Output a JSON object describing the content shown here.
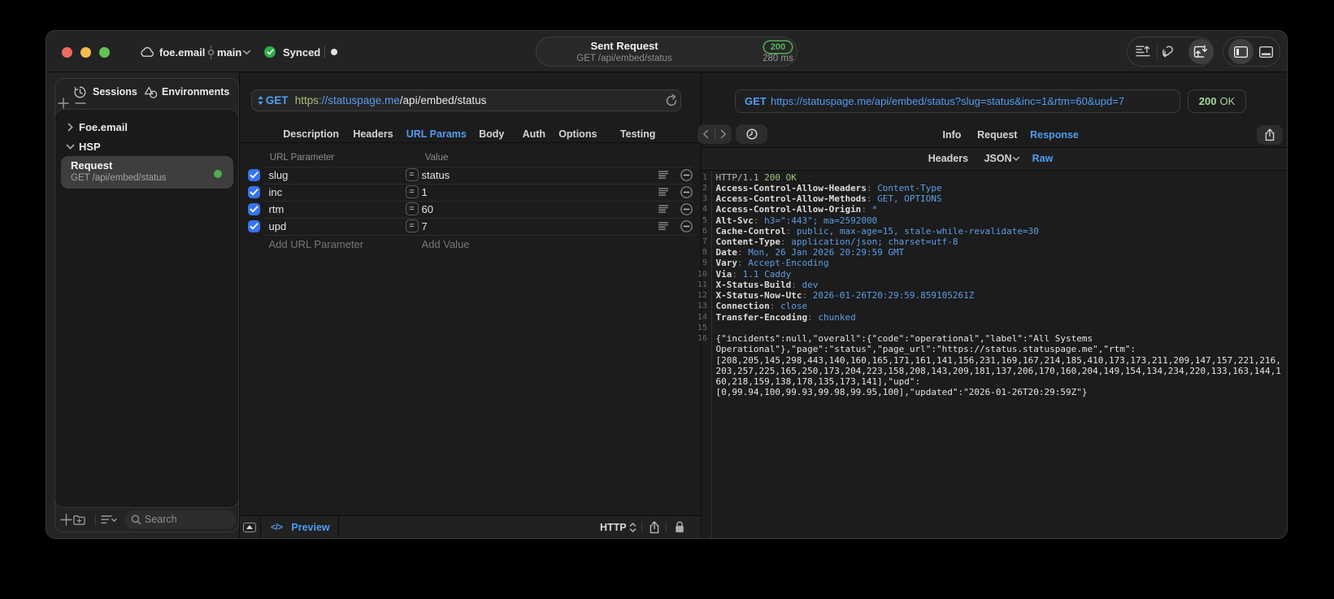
{
  "titlebar": {
    "project": "foe.email",
    "branch": "main",
    "sync_status": "Synced",
    "center_pill": {
      "title": "Sent Request",
      "subtitle": "GET /api/embed/status",
      "status_code": "200",
      "duration": "280 ms"
    }
  },
  "sidebar": {
    "tabs": [
      {
        "label": "Sessions",
        "icon": "history-clock-icon"
      },
      {
        "label": "Environments",
        "icon": "shapes-icon"
      }
    ],
    "tree": {
      "groups": [
        {
          "label": "Foe.email",
          "state": "collapsed"
        },
        {
          "label": "HSP",
          "state": "expanded"
        }
      ],
      "selected_item": {
        "title": "Request",
        "subtitle": "GET /api/embed/status",
        "status_dot_color": "#4caf50"
      }
    },
    "search_placeholder": "Search"
  },
  "request_editor": {
    "method": "GET",
    "url": {
      "scheme": "https",
      "colon": ":",
      "host": "//statuspage.me",
      "path": "/api/embed/status"
    },
    "tabs": [
      "Description",
      "Headers",
      "URL Params",
      "Body",
      "Auth",
      "Options",
      "Testing"
    ],
    "active_tab": "URL Params",
    "params_table": {
      "col_param": "URL Parameter",
      "col_value": "Value",
      "eq_symbol": "=",
      "rows": [
        {
          "name": "slug",
          "value": "status",
          "checked": true
        },
        {
          "name": "inc",
          "value": "1",
          "checked": true
        },
        {
          "name": "rtm",
          "value": "60",
          "checked": true
        },
        {
          "name": "upd",
          "value": "7",
          "checked": true
        }
      ],
      "add_param_placeholder": "Add URL Parameter",
      "add_value_placeholder": "Add Value"
    },
    "footer": {
      "code_glyph": "</>",
      "preview_label": "Preview",
      "protocol": "HTTP"
    }
  },
  "response_viewer": {
    "request_method": "GET",
    "request_url": "https://statuspage.me/api/embed/status?slug=status&inc=1&rtm=60&upd=7",
    "status_code": "200",
    "status_text": "OK",
    "tabs": [
      "Info",
      "Request",
      "Response"
    ],
    "active_tab": "Response",
    "subtabs": [
      "Headers",
      "JSON",
      "Raw"
    ],
    "active_subtab": "Raw",
    "raw_lines": [
      {
        "n": "1",
        "s": [
          [
            "HTTP/1.1 ",
            "sm"
          ],
          [
            "200 OK",
            "sg"
          ]
        ]
      },
      {
        "n": "2",
        "s": [
          [
            "Access-Control-Allow-Headers",
            "sn"
          ],
          [
            ": ",
            "sp"
          ],
          [
            "Content-Type",
            "sv"
          ]
        ]
      },
      {
        "n": "3",
        "s": [
          [
            "Access-Control-Allow-Methods",
            "sn"
          ],
          [
            ": ",
            "sp"
          ],
          [
            "GET, OPTIONS",
            "sv"
          ]
        ]
      },
      {
        "n": "4",
        "s": [
          [
            "Access-Control-Allow-Origin",
            "sn"
          ],
          [
            ": ",
            "sp"
          ],
          [
            "*",
            "sv"
          ]
        ]
      },
      {
        "n": "5",
        "s": [
          [
            "Alt-Svc",
            "sn"
          ],
          [
            ": ",
            "sp"
          ],
          [
            "h3=\":443\"; ma=2592000",
            "sv"
          ]
        ]
      },
      {
        "n": "6",
        "s": [
          [
            "Cache-Control",
            "sn"
          ],
          [
            ": ",
            "sp"
          ],
          [
            "public, max-age=15, stale-while-revalidate=30",
            "sv"
          ]
        ]
      },
      {
        "n": "7",
        "s": [
          [
            "Content-Type",
            "sn"
          ],
          [
            ": ",
            "sp"
          ],
          [
            "application/json; charset=utf-8",
            "sv"
          ]
        ]
      },
      {
        "n": "8",
        "s": [
          [
            "Date",
            "sn"
          ],
          [
            ": ",
            "sp"
          ],
          [
            "Mon, 26 Jan 2026 20:29:59 GMT",
            "sv"
          ]
        ]
      },
      {
        "n": "9",
        "s": [
          [
            "Vary",
            "sn"
          ],
          [
            ": ",
            "sp"
          ],
          [
            "Accept-Encoding",
            "sv"
          ]
        ]
      },
      {
        "n": "10",
        "s": [
          [
            "Via",
            "sn"
          ],
          [
            ": ",
            "sp"
          ],
          [
            "1.1 Caddy",
            "sv"
          ]
        ]
      },
      {
        "n": "11",
        "s": [
          [
            "X-Status-Build",
            "sn"
          ],
          [
            ": ",
            "sp"
          ],
          [
            "dev",
            "sv"
          ]
        ]
      },
      {
        "n": "12",
        "s": [
          [
            "X-Status-Now-Utc",
            "sn"
          ],
          [
            ": ",
            "sp"
          ],
          [
            "2026-01-26T20:29:59.859105261Z",
            "sv"
          ]
        ]
      },
      {
        "n": "13",
        "s": [
          [
            "Connection",
            "sn"
          ],
          [
            ": ",
            "sp"
          ],
          [
            "close",
            "sv"
          ]
        ]
      },
      {
        "n": "14",
        "s": [
          [
            "Transfer-Encoding",
            "sn"
          ],
          [
            ": ",
            "sp"
          ],
          [
            "chunked",
            "sv"
          ]
        ]
      },
      {
        "n": "15",
        "s": []
      },
      {
        "n": "16",
        "s": [
          [
            "{\"incidents\":null,\"overall\":{\"code\":\"operational\",\"label\":\"All Systems",
            "sb"
          ]
        ]
      },
      {
        "n": "",
        "s": [
          [
            "Operational\"},\"page\":\"status\",\"page_url\":\"https://status.statuspage.me\",\"rtm\":",
            "sb"
          ]
        ]
      },
      {
        "n": "",
        "s": [
          [
            "[208,205,145,298,443,140,160,165,171,161,141,156,231,169,167,214,185,410,173,173,211,209,147,157,221,216,",
            "sb"
          ]
        ]
      },
      {
        "n": "",
        "s": [
          [
            "203,257,225,165,250,173,204,223,158,208,143,209,181,137,206,170,160,204,149,154,134,234,220,133,163,144,1",
            "sb"
          ]
        ]
      },
      {
        "n": "",
        "s": [
          [
            "60,218,159,138,178,135,173,141],\"upd\":",
            "sb"
          ]
        ]
      },
      {
        "n": "",
        "s": [
          [
            "[0,99.94,100,99.93,99.98,99.95,100],\"updated\":\"2026-01-26T20:29:59Z\"}",
            "sb"
          ]
        ]
      }
    ]
  },
  "colors": {
    "accent_blue": "#4f9cf3",
    "checkbox_blue": "#3673f0",
    "status_green": "#55b154",
    "pale_green": "#a6d59a",
    "response_green": "#9cc87f",
    "url_scheme_green": "#a8bf77",
    "traffic_red": "#ee6a5f",
    "traffic_yellow": "#f5bd4f",
    "traffic_green": "#61c354"
  }
}
